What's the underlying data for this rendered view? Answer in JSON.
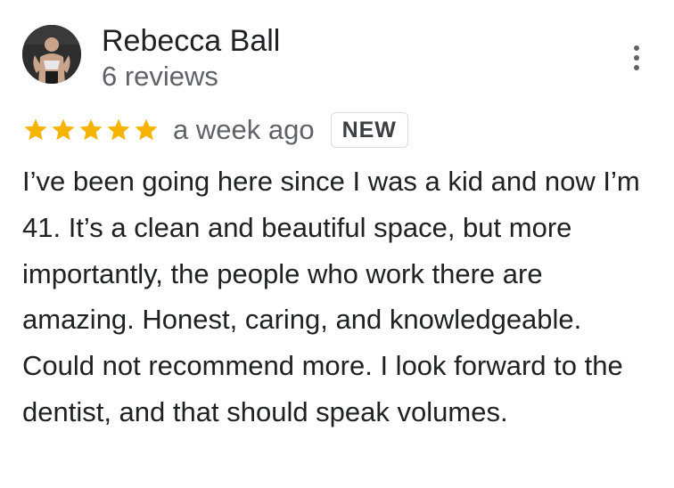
{
  "reviewer": {
    "name": "Rebecca Ball",
    "review_count": "6 reviews",
    "avatar": "profile-photo"
  },
  "rating": {
    "stars": 5,
    "max_stars": 5,
    "star_color": "#F4B400"
  },
  "meta": {
    "date": "a week ago",
    "badge": "NEW"
  },
  "review": {
    "text": "I’ve been going here since I was a kid and now I’m 41. It’s a clean and beautiful space, but more importantly, the people who work there are amazing. Honest, caring, and knowledgeable. Could not recommend more. I look forward to the dentist, and that should speak volumes."
  },
  "menu": {
    "icon": "more-vert-icon"
  }
}
